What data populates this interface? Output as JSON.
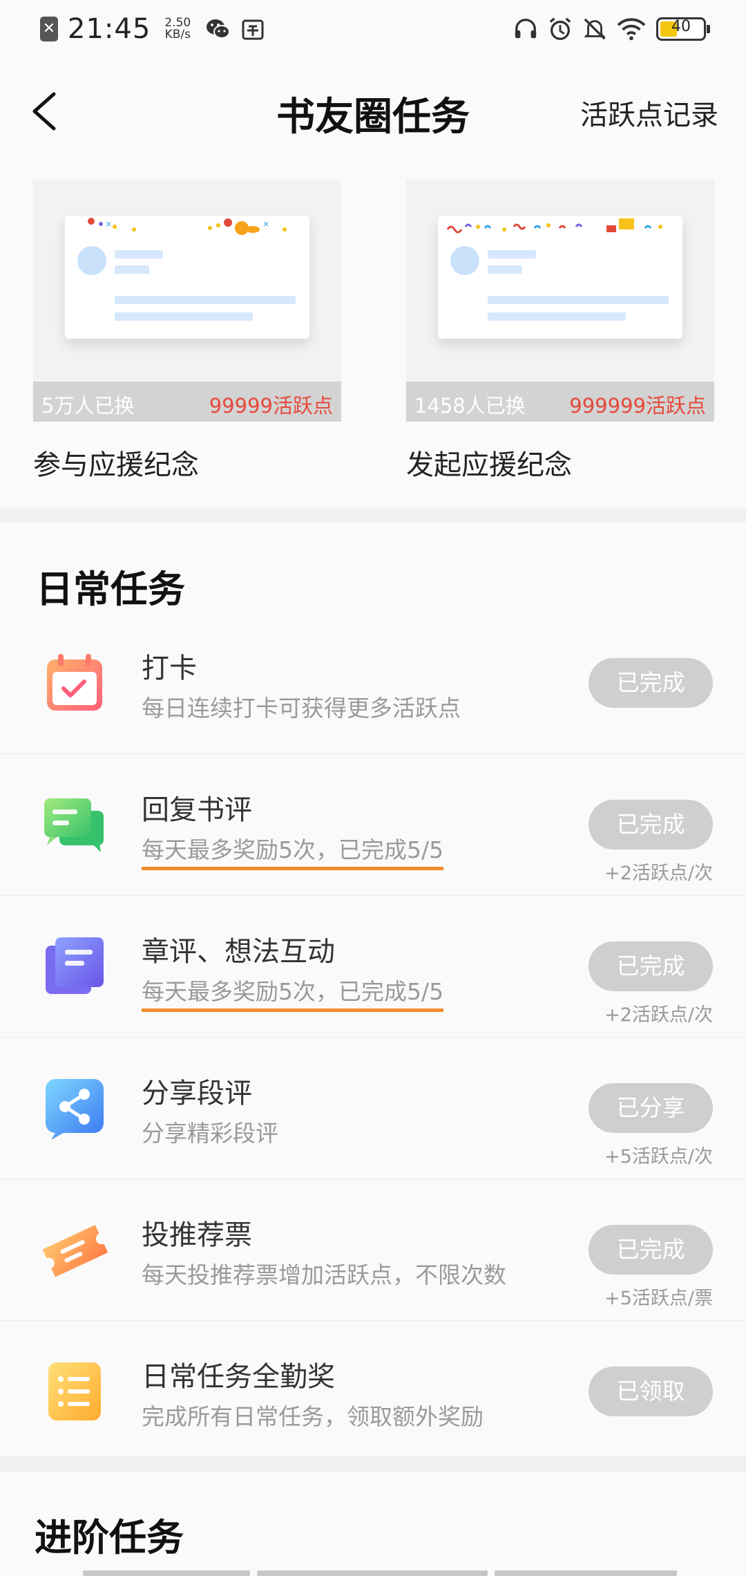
{
  "status_bar": {
    "time": "21:45",
    "net_speed_value": "2.50",
    "net_speed_unit": "KB/s",
    "battery_level": "40",
    "battery_fraction": 0.4,
    "icons": [
      "close-notification-icon",
      "wechat-icon",
      "shop-icon",
      "headset-icon",
      "alarm-icon",
      "mute-bell-icon",
      "wifi-icon",
      "battery-icon"
    ]
  },
  "header": {
    "title": "书友圈任务",
    "right_link": "活跃点记录",
    "back_icon": "chevron-left-icon"
  },
  "banners": [
    {
      "count": "5万人已换",
      "points": "99999活跃点",
      "label": "参与应援纪念"
    },
    {
      "count": "1458人已换",
      "points": "999999活跃点",
      "label": "发起应援纪念"
    }
  ],
  "daily": {
    "title": "日常任务",
    "tasks": [
      {
        "icon": "calendar-check-icon",
        "name": "打卡",
        "desc": "每日连续打卡可获得更多活跃点",
        "button": "已完成",
        "reward": ""
      },
      {
        "icon": "chat-bubbles-icon",
        "name": "回复书评",
        "desc": "每天最多奖励5次，已完成5/5",
        "button": "已完成",
        "reward": "+2活跃点/次"
      },
      {
        "icon": "document-stack-icon",
        "name": "章评、想法互动",
        "desc": "每天最多奖励5次，已完成5/5",
        "button": "已完成",
        "reward": "+2活跃点/次"
      },
      {
        "icon": "share-icon",
        "name": "分享段评",
        "desc": "分享精彩段评",
        "button": "已分享",
        "reward": "+5活跃点/次"
      },
      {
        "icon": "ticket-icon",
        "name": "投推荐票",
        "desc": "每天投推荐票增加活跃点，不限次数",
        "button": "已完成",
        "reward": "+5活跃点/票"
      },
      {
        "icon": "list-icon",
        "name": "日常任务全勤奖",
        "desc": "完成所有日常任务，领取额外奖励",
        "button": "已领取",
        "reward": ""
      }
    ]
  },
  "advanced": {
    "title": "进阶任务"
  },
  "colors": {
    "accent_red": "#e64a3b",
    "underline_orange": "#ef8a2b",
    "button_disabled": "#cfcfcf",
    "desc_gray": "#9a9a9a"
  }
}
